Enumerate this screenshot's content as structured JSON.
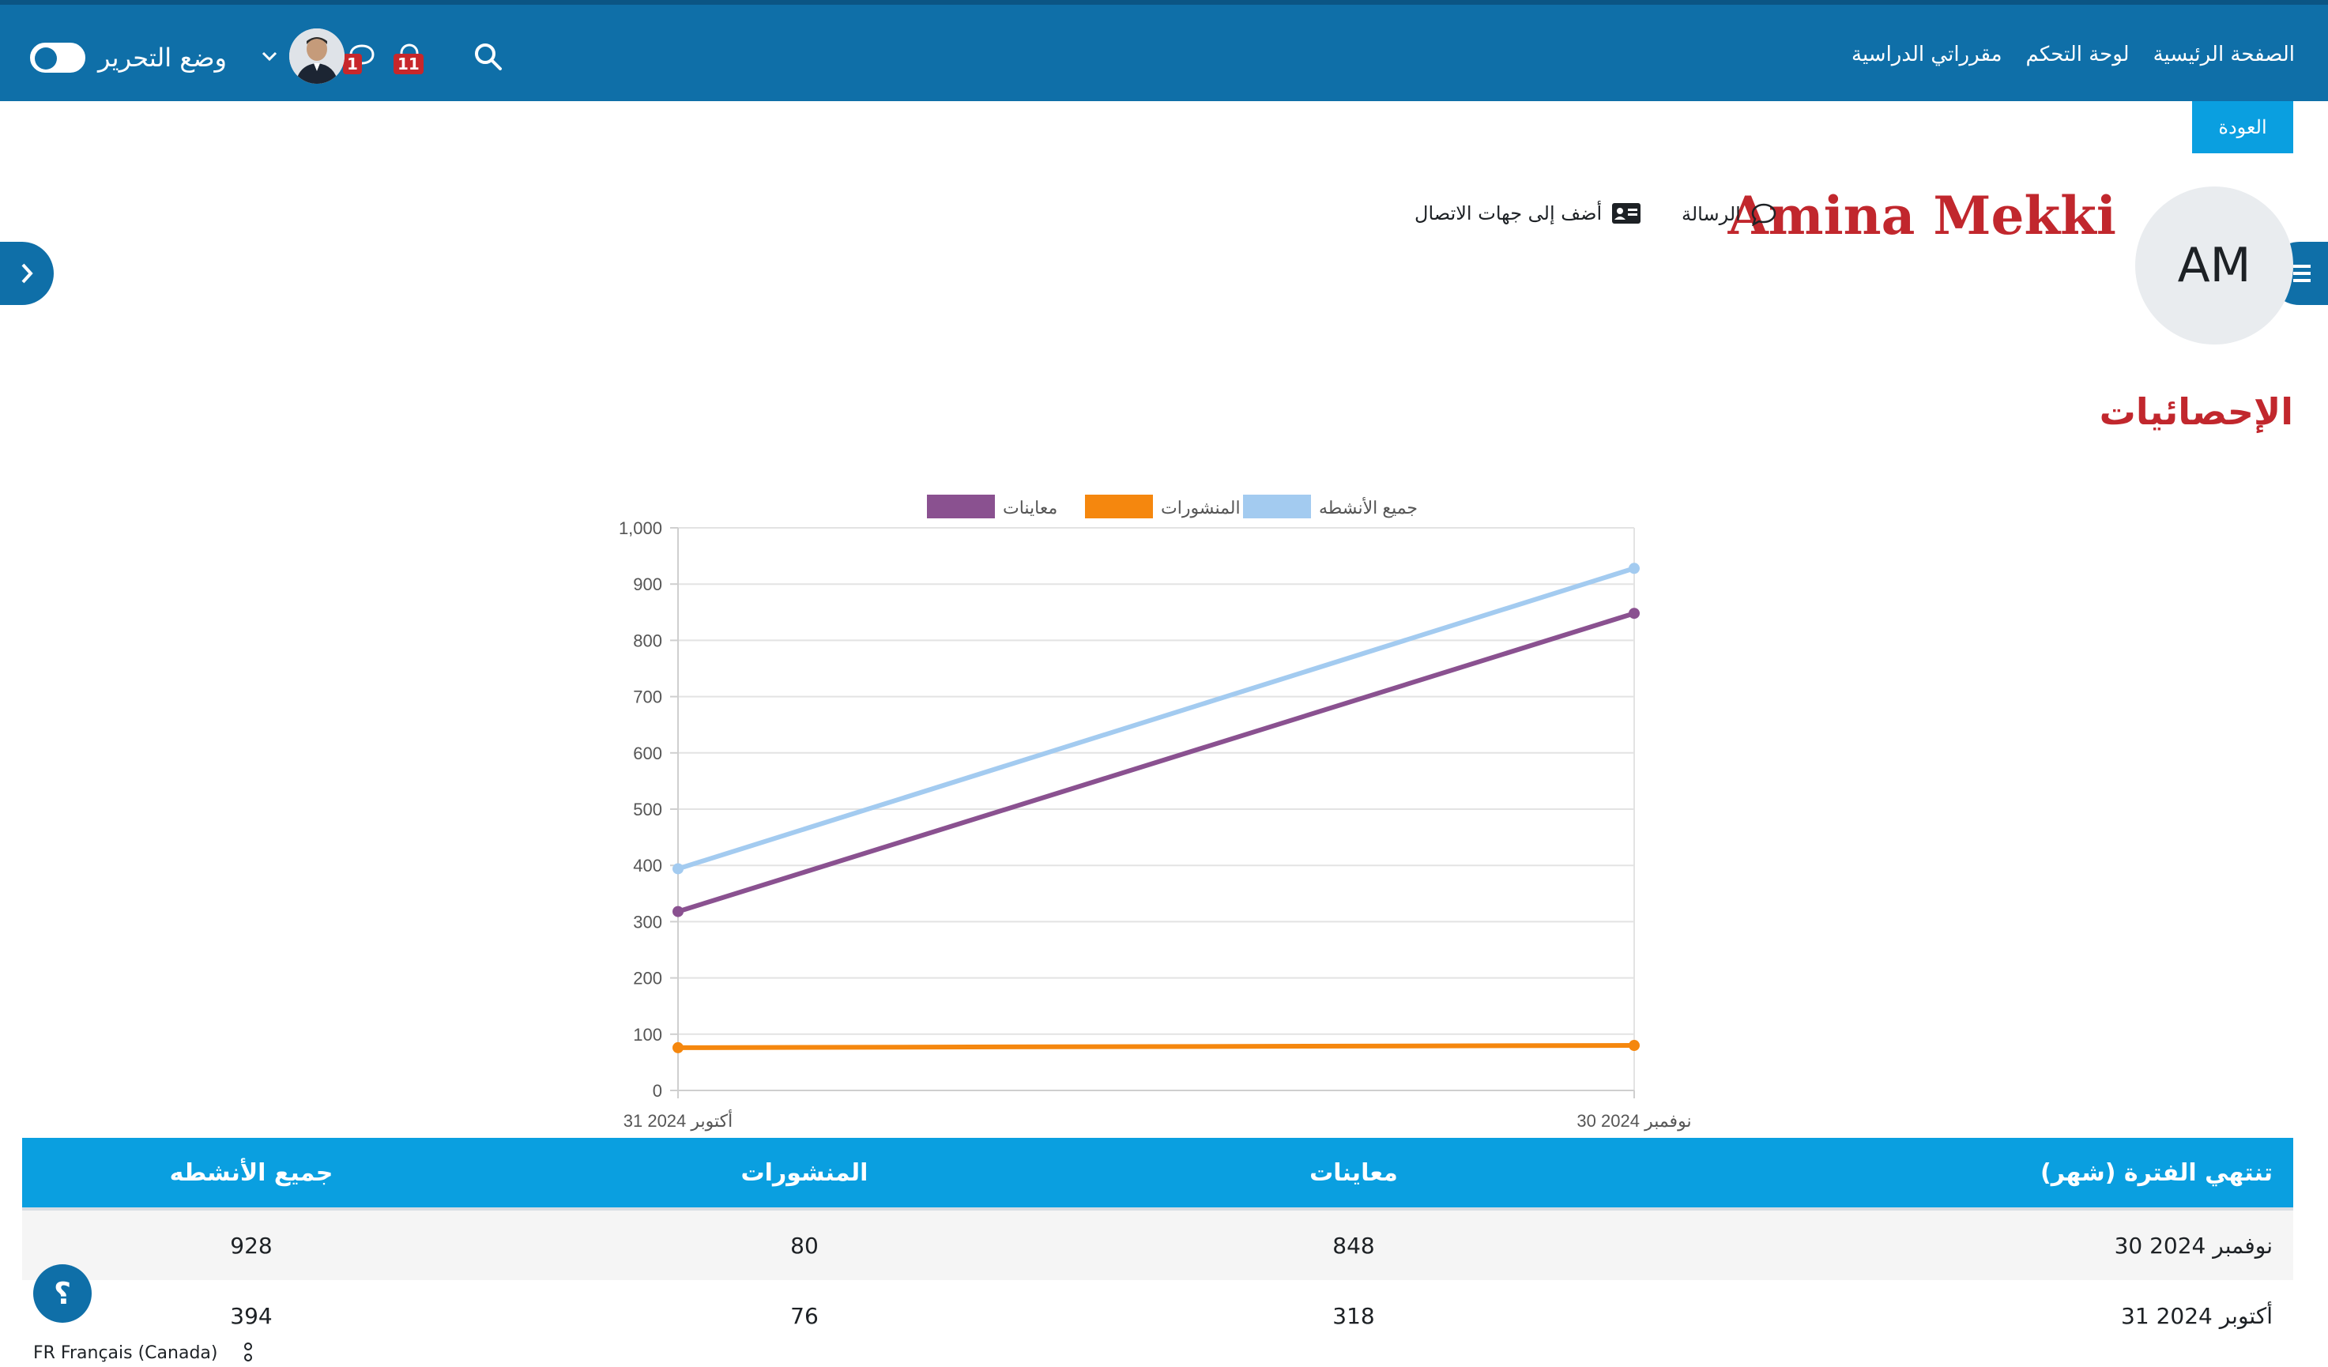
{
  "nav": {
    "links": [
      "الصفحة الرئيسية",
      "لوحة التحكم",
      "مقرراتي الدراسية"
    ],
    "notifications_count": "11",
    "messages_count": "1",
    "edit_mode_label": "وضع التحرير",
    "edit_mode_on": false
  },
  "back_label": "العودة",
  "profile": {
    "initials": "AM",
    "name": "Amina Mekki",
    "message_label": "الرسالة",
    "add_contact_label": "أضف إلى جهات الاتصال"
  },
  "section_title": "الإحصائيات",
  "chart_data": {
    "type": "line",
    "title": "",
    "categories": [
      "31 أكتوبر 2024",
      "30 نوفمبر 2024"
    ],
    "series": [
      {
        "name": "جميع الأنشطه",
        "color": "#a3cbf0",
        "values": [
          394,
          928
        ]
      },
      {
        "name": "المنشورات",
        "color": "#f5870e",
        "values": [
          76,
          80
        ]
      },
      {
        "name": "معاينات",
        "color": "#8a5190",
        "values": [
          318,
          848
        ]
      }
    ],
    "ylim": [
      0,
      1000
    ],
    "yticks": [
      "0",
      "100",
      "200",
      "300",
      "400",
      "500",
      "600",
      "700",
      "800",
      "900",
      "1,000"
    ],
    "grid": true,
    "legend": "top-center"
  },
  "table": {
    "headers": {
      "period": "تنتهي الفترة (شهر)",
      "views": "معاينات",
      "posts": "المنشورات",
      "all": "جميع الأنشطه"
    },
    "rows": [
      {
        "period": "30 نوفمبر 2024",
        "views": "848",
        "posts": "80",
        "all": "928"
      },
      {
        "period": "31 أكتوبر 2024",
        "views": "318",
        "posts": "76",
        "all": "394"
      }
    ]
  },
  "help_label": "؟",
  "language_label": "FR Français (Canada)",
  "colors": {
    "navbar": "#0f6fa8",
    "accent": "#0a9fe0",
    "title_red": "#c1272d"
  }
}
